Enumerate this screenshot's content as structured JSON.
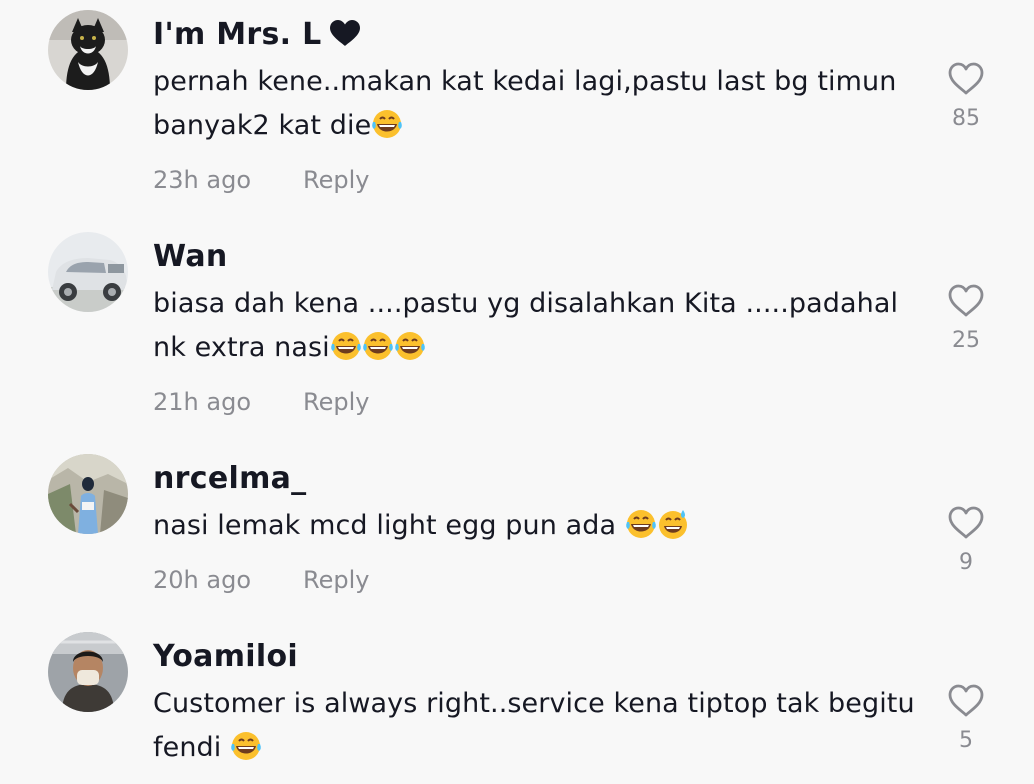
{
  "comments": [
    {
      "username": "I'm Mrs. L",
      "username_suffix_icon": "heart-icon",
      "text": "pernah kene..makan kat kedai lagi,pastu last bg timun banyak2 kat die",
      "emojis": [
        "joy"
      ],
      "time": "23h ago",
      "reply_label": "Reply",
      "likes": "85"
    },
    {
      "username": "Wan",
      "text": "biasa dah kena ....pastu yg disalahkan Kita .....padahal nk extra nasi",
      "emojis": [
        "joy",
        "joy",
        "joy"
      ],
      "time": "21h ago",
      "reply_label": "Reply",
      "likes": "25"
    },
    {
      "username": "nrcelma_",
      "text": "nasi lemak mcd light egg pun ada ",
      "emojis": [
        "joy",
        "sweat_smile"
      ],
      "time": "20h ago",
      "reply_label": "Reply",
      "likes": "9"
    },
    {
      "username": "Yoamiloi",
      "text": "Customer is always right..service kena tiptop tak begitu fendi ",
      "emojis": [
        "joy"
      ],
      "likes": "5"
    }
  ],
  "colors": {
    "background": "#f8f8f8",
    "primary_text": "#161823",
    "secondary_text": "#8a8b91"
  }
}
